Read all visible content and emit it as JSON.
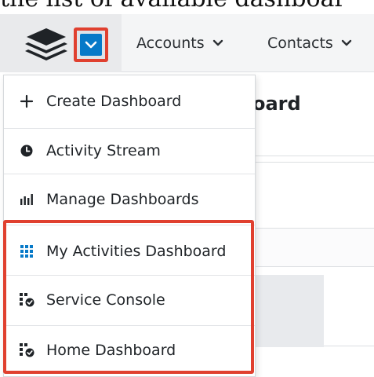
{
  "caption": "the list of available dashboar",
  "navbar": {
    "logo_icon": "layers-stack-icon",
    "menu_toggle_icon": "chevron-down-icon",
    "items": [
      {
        "label": "Accounts",
        "icon": "chevron-down-icon"
      },
      {
        "label": "Contacts",
        "icon": "chevron-down-icon"
      }
    ]
  },
  "background": {
    "title_fragment": "oard"
  },
  "dropdown": {
    "items": [
      {
        "label": "Create Dashboard",
        "icon": "plus-icon"
      },
      {
        "label": "Activity Stream",
        "icon": "clock-icon"
      },
      {
        "label": "Manage Dashboards",
        "icon": "bar-chart-icon"
      },
      {
        "label": "My Activities Dashboard",
        "icon": "grid-icon"
      },
      {
        "label": "Service Console",
        "icon": "checklist-icon"
      },
      {
        "label": "Home Dashboard",
        "icon": "checklist-icon"
      }
    ]
  },
  "colors": {
    "accent": "#0679c8",
    "highlight": "#e0402f"
  }
}
